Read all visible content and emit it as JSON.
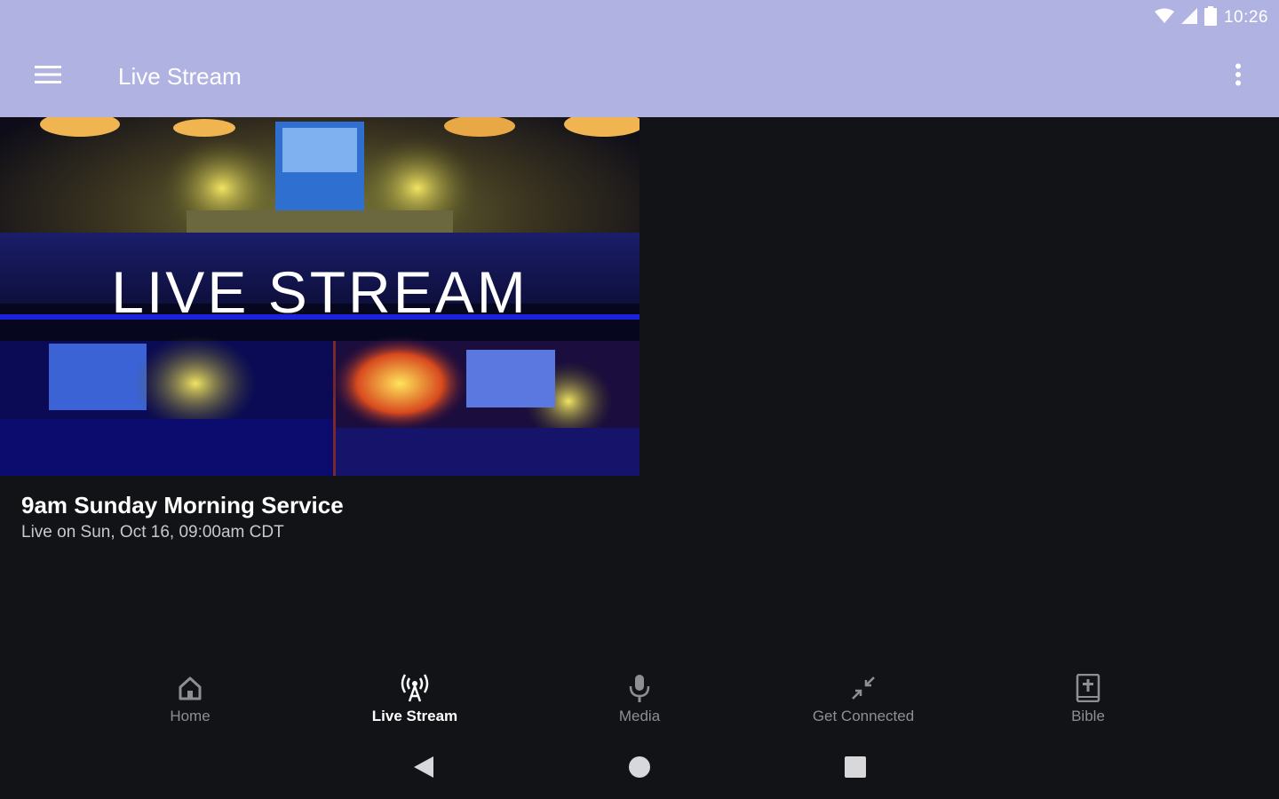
{
  "status_bar": {
    "time": "10:26",
    "icons": [
      "wifi-icon",
      "cell-signal-icon",
      "battery-icon"
    ]
  },
  "app_bar": {
    "title": "Live Stream",
    "menu_icon": "hamburger-menu-icon",
    "overflow_icon": "more-vert-icon",
    "background": "#b0b3e2"
  },
  "stream_card": {
    "banner_text": "LIVE STREAM",
    "title": "9am Sunday Morning Service",
    "subtitle": "Live on Sun, Oct 16, 09:00am CDT"
  },
  "bottom_nav": {
    "items": [
      {
        "label": "Home",
        "icon": "home-icon",
        "active": false
      },
      {
        "label": "Live Stream",
        "icon": "broadcast-icon",
        "active": true
      },
      {
        "label": "Media",
        "icon": "microphone-icon",
        "active": false
      },
      {
        "label": "Get Connected",
        "icon": "collapse-arrows-icon",
        "active": false
      },
      {
        "label": "Bible",
        "icon": "bible-icon",
        "active": false
      }
    ]
  },
  "system_nav": {
    "icons": [
      "back-icon",
      "home-circle-icon",
      "recents-icon"
    ]
  },
  "colors": {
    "background": "#121316",
    "text_primary": "#ffffff",
    "text_secondary": "#c9c9cc",
    "nav_inactive": "#8e8f93"
  }
}
